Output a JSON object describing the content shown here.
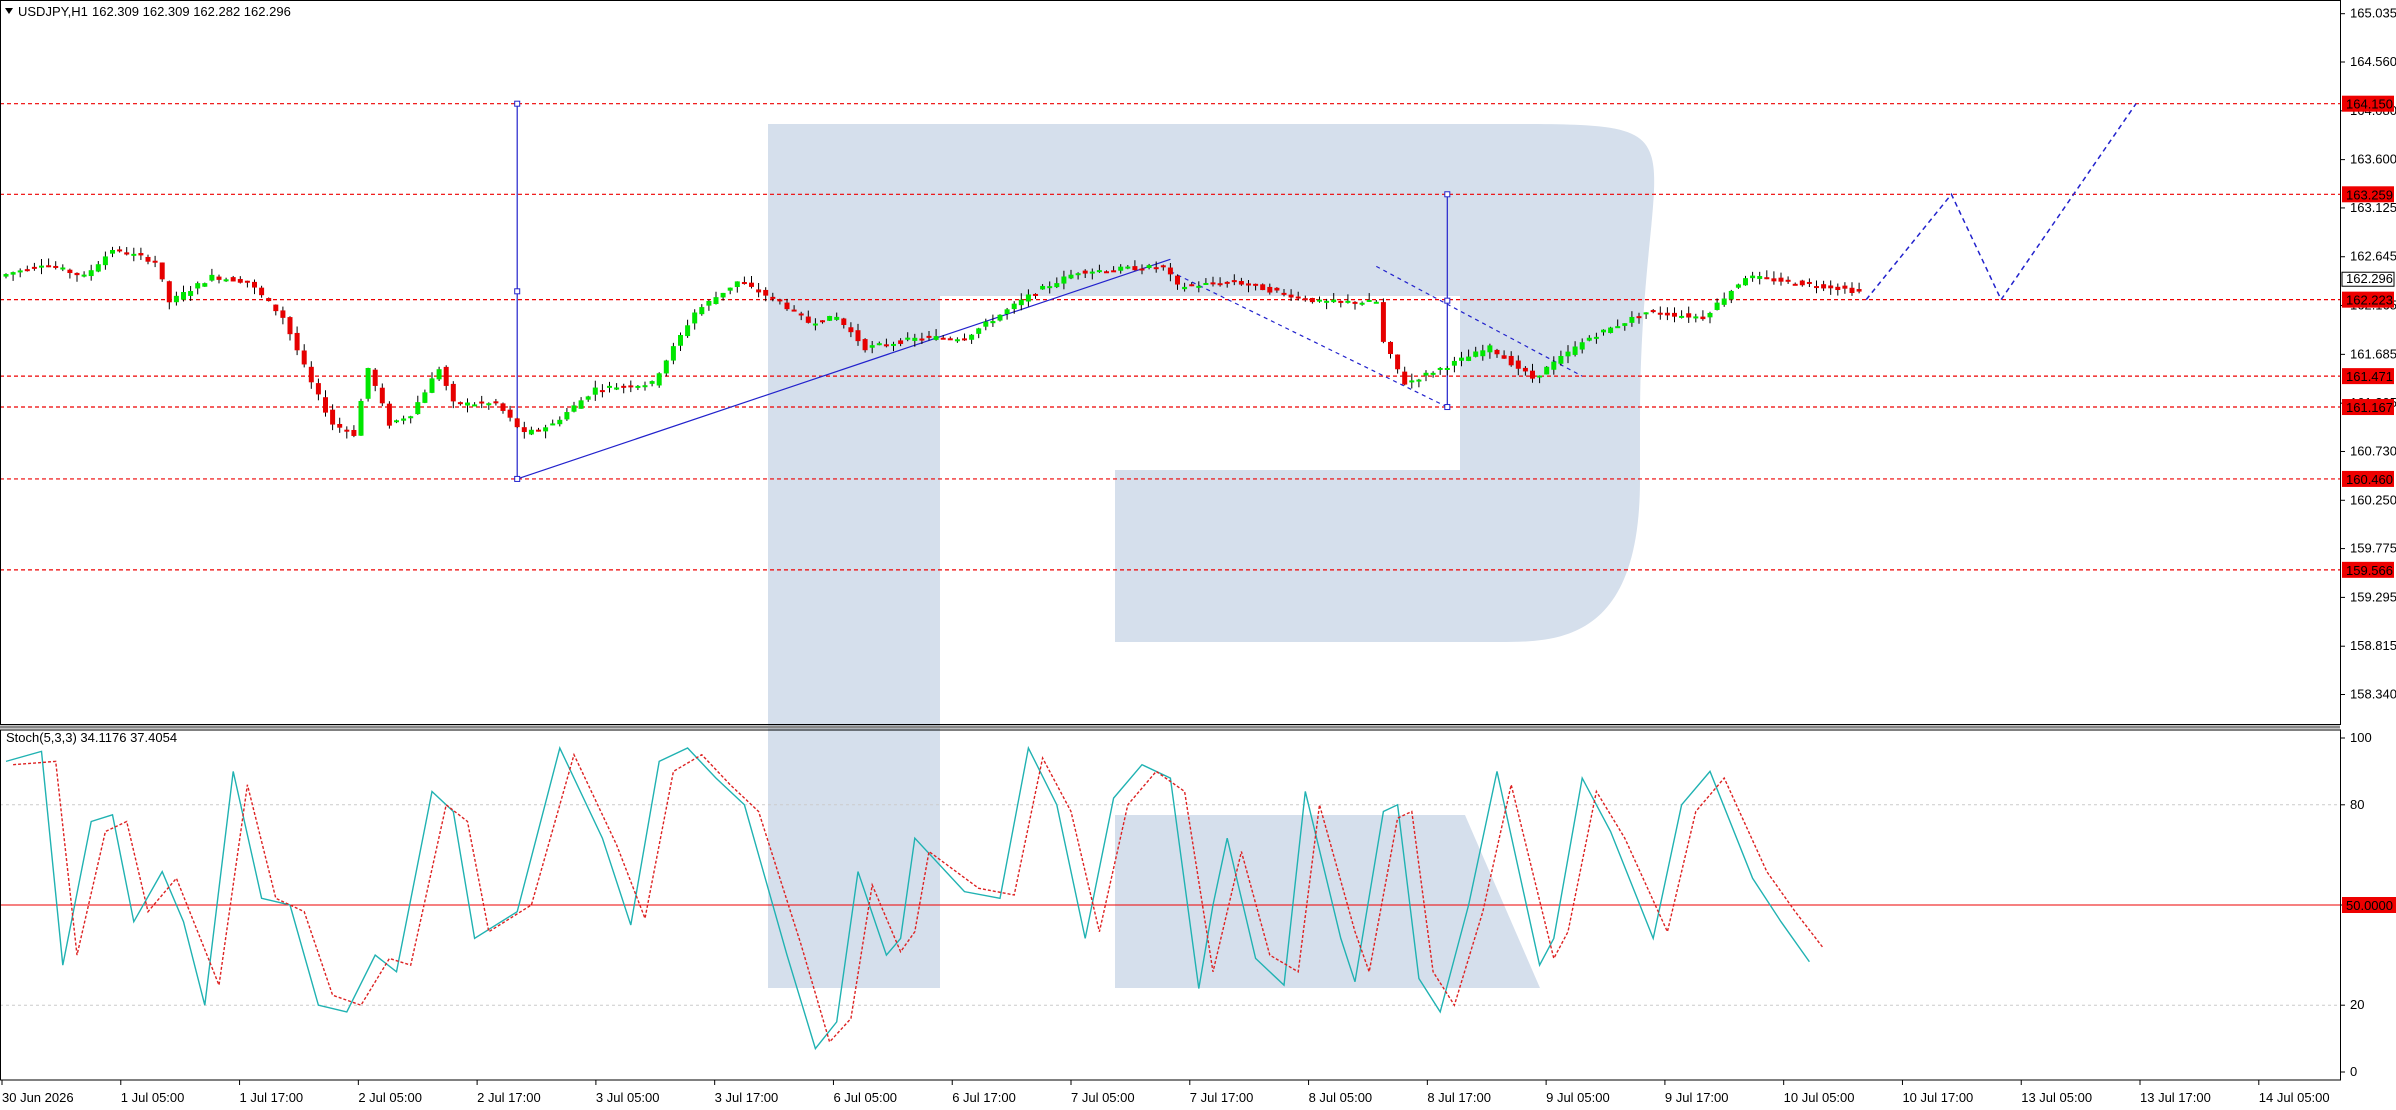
{
  "header": {
    "symbol": "USDJPY,H1",
    "ohlc": "162.309 162.309 162.282 162.296"
  },
  "indicator": {
    "label": "Stoch(5,3,3) 34.1176 37.4054"
  },
  "colors": {
    "bull": "#00e600",
    "bear": "#e60000",
    "level": "#ee0000",
    "trend": "#2222cc",
    "stoch_main": "#20b2b2",
    "stoch_signal": "#dd2222",
    "watermark": "#d5dfec",
    "grid": "#cccccc"
  },
  "chart_data": [
    {
      "type": "candlestick",
      "title": "USDJPY,H1",
      "ylim": [
        158.05,
        165.15
      ],
      "y_ticks": [
        "165.035",
        "164.560",
        "164.080",
        "163.600",
        "163.125",
        "162.645",
        "162.165",
        "161.685",
        "161.205",
        "160.730",
        "160.250",
        "159.775",
        "159.295",
        "158.815",
        "158.340"
      ],
      "x_ticks": [
        "30 Jun 2026",
        "1 Jul 05:00",
        "1 Jul 17:00",
        "2 Jul 05:00",
        "2 Jul 17:00",
        "3 Jul 05:00",
        "3 Jul 17:00",
        "6 Jul 05:00",
        "6 Jul 17:00",
        "7 Jul 05:00",
        "7 Jul 17:00",
        "8 Jul 05:00",
        "8 Jul 17:00",
        "9 Jul 05:00",
        "9 Jul 17:00",
        "10 Jul 05:00",
        "10 Jul 17:00",
        "13 Jul 05:00",
        "13 Jul 17:00",
        "14 Jul 05:00"
      ],
      "levels": [
        {
          "value": 164.15,
          "label": "164.150"
        },
        {
          "value": 163.259,
          "label": "163.259"
        },
        {
          "value": 162.223,
          "label": "162.223"
        },
        {
          "value": 161.471,
          "label": "161.471"
        },
        {
          "value": 161.167,
          "label": "161.167"
        },
        {
          "value": 160.46,
          "label": "160.460"
        },
        {
          "value": 159.566,
          "label": "159.566"
        }
      ],
      "current_price": {
        "value": 162.296,
        "label": "162.296"
      },
      "price_path": [
        [
          0,
          162.45
        ],
        [
          6,
          162.58
        ],
        [
          12,
          162.45
        ],
        [
          16,
          162.72
        ],
        [
          22,
          162.6
        ],
        [
          24,
          162.2
        ],
        [
          30,
          162.45
        ],
        [
          35,
          162.4
        ],
        [
          40,
          162.05
        ],
        [
          44,
          161.4
        ],
        [
          47,
          161.0
        ],
        [
          50,
          160.9
        ],
        [
          52,
          161.55
        ],
        [
          55,
          161.0
        ],
        [
          58,
          161.1
        ],
        [
          62,
          161.55
        ],
        [
          64,
          161.2
        ],
        [
          70,
          161.2
        ],
        [
          74,
          160.9
        ],
        [
          78,
          161.0
        ],
        [
          84,
          161.35
        ],
        [
          92,
          161.4
        ],
        [
          98,
          162.1
        ],
        [
          104,
          162.4
        ],
        [
          110,
          162.2
        ],
        [
          114,
          162.0
        ],
        [
          118,
          162.05
        ],
        [
          122,
          161.75
        ],
        [
          130,
          161.85
        ],
        [
          136,
          161.85
        ],
        [
          146,
          162.3
        ],
        [
          152,
          162.5
        ],
        [
          164,
          162.55
        ],
        [
          166,
          162.35
        ],
        [
          174,
          162.4
        ],
        [
          180,
          162.3
        ],
        [
          186,
          162.2
        ],
        [
          194,
          162.2
        ],
        [
          195,
          161.8
        ],
        [
          198,
          161.4
        ],
        [
          210,
          161.75
        ],
        [
          214,
          161.55
        ],
        [
          216,
          161.45
        ],
        [
          224,
          161.85
        ],
        [
          232,
          162.1
        ],
        [
          240,
          162.05
        ],
        [
          246,
          162.45
        ],
        [
          258,
          162.35
        ],
        [
          262,
          162.3
        ]
      ],
      "forecast_path": [
        [
          262,
          162.223
        ],
        [
          274,
          163.259
        ],
        [
          281,
          162.223
        ],
        [
          300,
          164.15
        ]
      ],
      "trend_lines": [
        {
          "x0": 72,
          "y0": 160.46,
          "x1": 164,
          "y1": 162.62,
          "style": "solid"
        },
        {
          "x0": 164,
          "y0": 162.5,
          "x1": 203,
          "y1": 161.167,
          "style": "dashed"
        },
        {
          "x0": 193,
          "y0": 162.55,
          "x1": 222,
          "y1": 161.471,
          "style": "dashed"
        },
        {
          "x0": 72,
          "y0": 164.15,
          "x1": 72,
          "y1": 160.46,
          "style": "solid"
        },
        {
          "x0": 203,
          "y0": 163.259,
          "x1": 203,
          "y1": 161.167,
          "style": "solid"
        }
      ],
      "n_bars": 262
    },
    {
      "type": "line",
      "title": "Stoch(5,3,3) 34.1176 37.4054",
      "ylim": [
        0,
        100
      ],
      "y_ticks": [
        "100",
        "80",
        "50.0000",
        "20",
        "0"
      ],
      "series": [
        {
          "values": [
            [
              0,
              93
            ],
            [
              5,
              96
            ],
            [
              8,
              32
            ],
            [
              12,
              75
            ],
            [
              15,
              77
            ],
            [
              18,
              45
            ],
            [
              22,
              60
            ],
            [
              25,
              45
            ],
            [
              28,
              20
            ],
            [
              32,
              90
            ],
            [
              36,
              52
            ],
            [
              40,
              50
            ],
            [
              44,
              20
            ],
            [
              48,
              18
            ],
            [
              52,
              35
            ],
            [
              55,
              30
            ],
            [
              60,
              84
            ],
            [
              63,
              78
            ],
            [
              66,
              40
            ],
            [
              72,
              48
            ],
            [
              78,
              97
            ],
            [
              84,
              70
            ],
            [
              88,
              44
            ],
            [
              92,
              93
            ],
            [
              96,
              97
            ],
            [
              100,
              88
            ],
            [
              104,
              80
            ],
            [
              110,
              35
            ],
            [
              114,
              7
            ],
            [
              117,
              15
            ],
            [
              120,
              60
            ],
            [
              124,
              35
            ],
            [
              126,
              40
            ],
            [
              128,
              70
            ],
            [
              135,
              54
            ],
            [
              140,
              52
            ],
            [
              144,
              97
            ],
            [
              148,
              80
            ],
            [
              152,
              40
            ],
            [
              156,
              82
            ],
            [
              160,
              92
            ],
            [
              164,
              88
            ],
            [
              168,
              25
            ],
            [
              170,
              50
            ],
            [
              172,
              70
            ],
            [
              176,
              34
            ],
            [
              180,
              26
            ],
            [
              183,
              84
            ],
            [
              188,
              40
            ],
            [
              190,
              27
            ],
            [
              194,
              78
            ],
            [
              196,
              80
            ],
            [
              199,
              28
            ],
            [
              202,
              18
            ],
            [
              206,
              50
            ],
            [
              210,
              90
            ],
            [
              216,
              32
            ],
            [
              218,
              40
            ],
            [
              222,
              88
            ],
            [
              226,
              72
            ],
            [
              232,
              40
            ],
            [
              236,
              80
            ],
            [
              240,
              90
            ],
            [
              246,
              58
            ],
            [
              250,
              45
            ],
            [
              254,
              33
            ]
          ]
        },
        {
          "values": [
            [
              1,
              92
            ],
            [
              7,
              93
            ],
            [
              10,
              35
            ],
            [
              14,
              72
            ],
            [
              17,
              75
            ],
            [
              20,
              48
            ],
            [
              24,
              58
            ],
            [
              27,
              42
            ],
            [
              30,
              26
            ],
            [
              34,
              86
            ],
            [
              38,
              52
            ],
            [
              42,
              48
            ],
            [
              46,
              23
            ],
            [
              50,
              20
            ],
            [
              54,
              34
            ],
            [
              57,
              32
            ],
            [
              62,
              80
            ],
            [
              65,
              75
            ],
            [
              68,
              42
            ],
            [
              74,
              50
            ],
            [
              80,
              95
            ],
            [
              86,
              68
            ],
            [
              90,
              46
            ],
            [
              94,
              90
            ],
            [
              98,
              95
            ],
            [
              102,
              86
            ],
            [
              106,
              78
            ],
            [
              112,
              38
            ],
            [
              116,
              9
            ],
            [
              119,
              16
            ],
            [
              122,
              56
            ],
            [
              126,
              36
            ],
            [
              128,
              42
            ],
            [
              130,
              66
            ],
            [
              137,
              55
            ],
            [
              142,
              53
            ],
            [
              146,
              94
            ],
            [
              150,
              78
            ],
            [
              154,
              42
            ],
            [
              158,
              80
            ],
            [
              162,
              90
            ],
            [
              166,
              84
            ],
            [
              170,
              30
            ],
            [
              172,
              48
            ],
            [
              174,
              66
            ],
            [
              178,
              35
            ],
            [
              182,
              30
            ],
            [
              185,
              80
            ],
            [
              190,
              42
            ],
            [
              192,
              30
            ],
            [
              196,
              76
            ],
            [
              198,
              78
            ],
            [
              201,
              30
            ],
            [
              204,
              20
            ],
            [
              208,
              48
            ],
            [
              212,
              86
            ],
            [
              218,
              34
            ],
            [
              220,
              42
            ],
            [
              224,
              84
            ],
            [
              228,
              70
            ],
            [
              234,
              42
            ],
            [
              238,
              78
            ],
            [
              242,
              88
            ],
            [
              248,
              60
            ],
            [
              252,
              48
            ],
            [
              256,
              37
            ]
          ]
        }
      ],
      "levels": [
        {
          "value": 50,
          "label": "50.0000"
        }
      ]
    }
  ]
}
